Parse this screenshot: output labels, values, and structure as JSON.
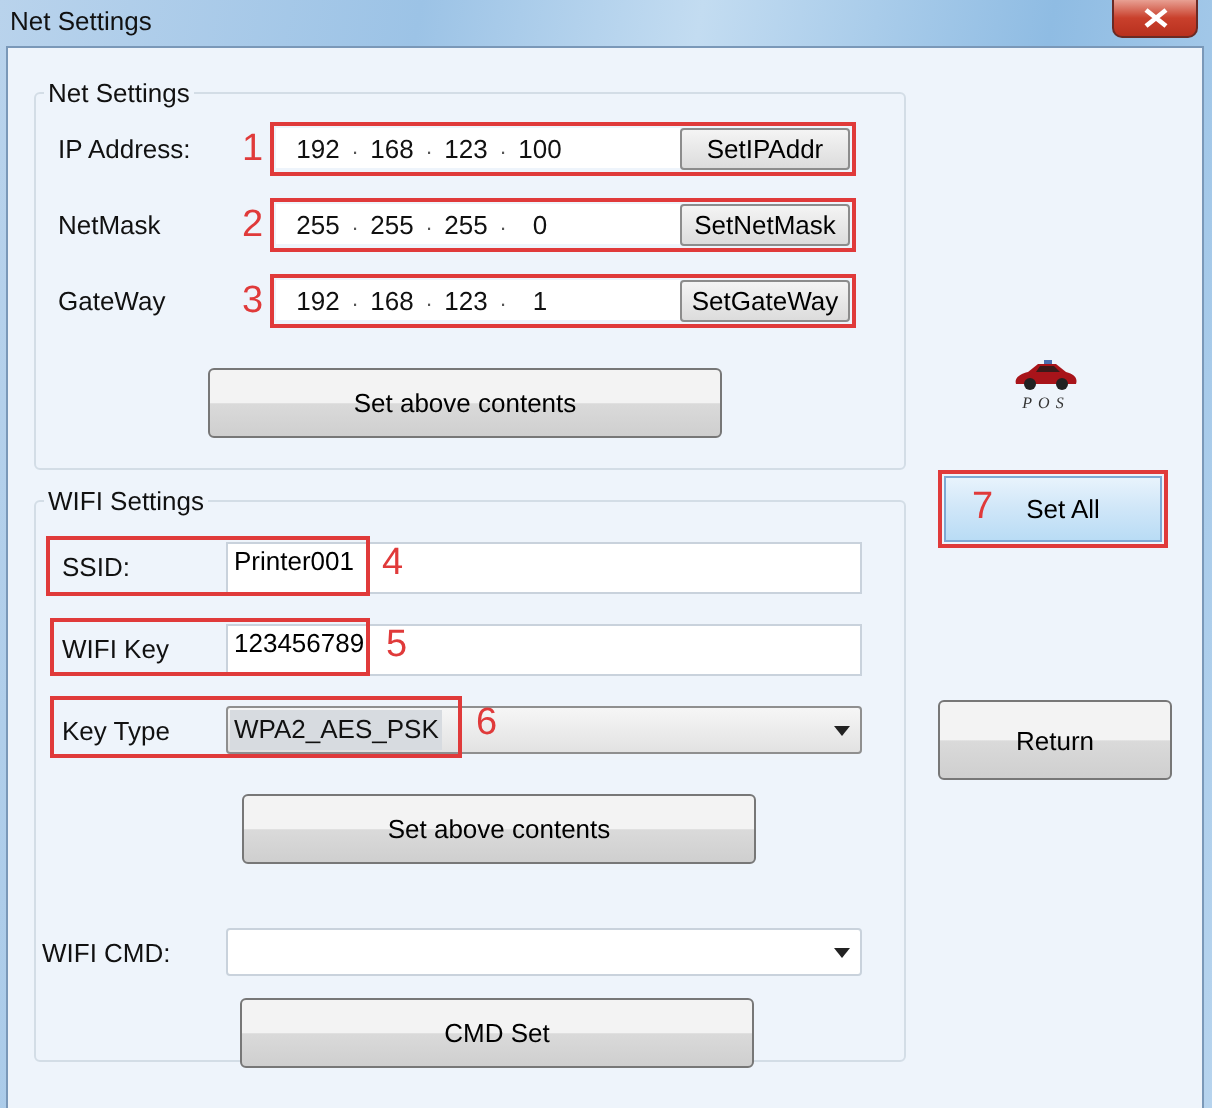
{
  "window": {
    "title": "Net Settings"
  },
  "net_settings": {
    "title": "Net Settings",
    "rows": [
      {
        "label": "IP Address:",
        "annotation": "1",
        "octets": [
          "192",
          "168",
          "123",
          "100"
        ],
        "separator": ".",
        "button": "SetIPAddr"
      },
      {
        "label": "NetMask",
        "annotation": "2",
        "octets": [
          "255",
          "255",
          "255",
          "0"
        ],
        "separator": ".",
        "button": "SetNetMask"
      },
      {
        "label": "GateWay",
        "annotation": "3",
        "octets": [
          "192",
          "168",
          "123",
          "1"
        ],
        "separator": ".",
        "button": "SetGateWay"
      }
    ],
    "submit": "Set above contents"
  },
  "logo": {
    "text": "POS"
  },
  "wifi_settings": {
    "title": "WIFI Settings",
    "fields": [
      {
        "kind": "text",
        "label": "SSID:",
        "value": "Printer001",
        "annotation": "4"
      },
      {
        "kind": "text",
        "label": "WIFI Key",
        "value": "123456789",
        "annotation": "5"
      },
      {
        "kind": "select",
        "label": "Key Type",
        "value": "WPA2_AES_PSK",
        "annotation": "6"
      }
    ],
    "submit": "Set above contents",
    "cmd": {
      "label": "WIFI CMD:"
    },
    "cmd_button": "CMD Set"
  },
  "set_all": {
    "label": "Set All",
    "annotation": "7"
  },
  "return_button": "Return"
}
